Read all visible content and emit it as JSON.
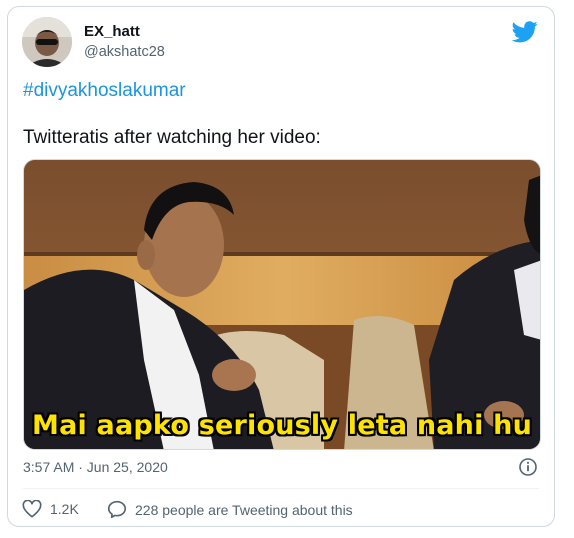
{
  "tweet": {
    "author": {
      "name": "EX_hatt",
      "handle": "@akshatc28"
    },
    "hashtag": "#divyakhoslakumar",
    "text": "Twitteratis after watching her video:",
    "media": {
      "caption": "Mai aapko seriously leta nahi hu"
    },
    "timestamp": "3:57 AM · Jun 25, 2020",
    "likes": "1.2K",
    "conversation": "228 people are Tweeting about this"
  },
  "colors": {
    "brand": "#1da1f2",
    "link": "#1b95e0",
    "secondary_text": "#536471",
    "caption": "#ffe300"
  },
  "icons": {
    "brand": "twitter-bird-icon",
    "info": "info-icon",
    "like": "heart-icon",
    "conversation": "speech-bubble-icon"
  }
}
